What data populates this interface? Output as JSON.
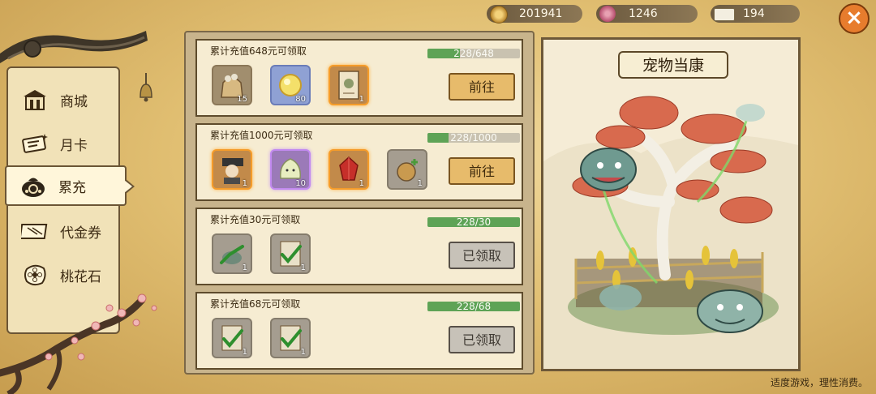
{
  "currencies": {
    "coins": {
      "value": "201941",
      "icon": "coin-icon"
    },
    "gems": {
      "value": "1246",
      "icon": "peach-gem-icon"
    },
    "tickets": {
      "value": "194",
      "icon": "voucher-ticket-icon"
    }
  },
  "close_label": "×",
  "nav": {
    "items": [
      {
        "label": "商城",
        "icon": "shop-icon"
      },
      {
        "label": "月卡",
        "icon": "monthly-card-icon"
      },
      {
        "label": "累充",
        "icon": "money-bag-icon",
        "active": true
      },
      {
        "label": "代金券",
        "icon": "voucher-icon"
      },
      {
        "label": "桃花石",
        "icon": "peach-blossom-stone-icon"
      }
    ]
  },
  "rewards": [
    {
      "title": "累计充值648元可领取",
      "progress_text": "228/648",
      "progress": 0.35,
      "button": "前往",
      "button_state": "go",
      "items": [
        {
          "icon": "food-bag-icon",
          "count": "15",
          "quality": "brown"
        },
        {
          "icon": "golden-orb-icon",
          "count": "80",
          "quality": "blue"
        },
        {
          "icon": "scroll-card-icon",
          "count": "1",
          "quality": "orange"
        }
      ]
    },
    {
      "title": "累计充值1000元可领取",
      "progress_text": "228/1000",
      "progress": 0.23,
      "button": "前往",
      "button_state": "go",
      "items": [
        {
          "icon": "character-portrait-icon",
          "count": "1",
          "quality": "orange"
        },
        {
          "icon": "dumpling-pet-icon",
          "count": "10",
          "quality": "purple"
        },
        {
          "icon": "red-crystal-icon",
          "count": "1",
          "quality": "orange"
        },
        {
          "icon": "growth-pouch-icon",
          "count": "1",
          "quality": "gray"
        }
      ]
    },
    {
      "title": "累计充值30元可领取",
      "progress_text": "228/30",
      "progress": 1,
      "button": "已领取",
      "button_state": "claimed",
      "items": [
        {
          "icon": "pet-creature-icon",
          "count": "1",
          "quality": "gray",
          "checked": true
        },
        {
          "icon": "item-checked-icon",
          "count": "1",
          "quality": "gray",
          "checked": true
        }
      ]
    },
    {
      "title": "累计充值68元可领取",
      "progress_text": "228/68",
      "progress": 1,
      "button": "已领取",
      "button_state": "claimed",
      "items": [
        {
          "icon": "item-checked-icon",
          "count": "1",
          "quality": "gray",
          "checked": true
        },
        {
          "icon": "item-checked-icon",
          "count": "1",
          "quality": "gray",
          "checked": true
        }
      ]
    }
  ],
  "showcase": {
    "title": "宠物当康",
    "illustration": "pet-dangkang-tree-illustration"
  },
  "footer": "适度游戏，理性消费。",
  "colors": {
    "progress_fill": "#5ea356",
    "go_button": "#e7bb6b",
    "claimed_button": "#c7c2b8",
    "close_button": "#e77c2d"
  }
}
